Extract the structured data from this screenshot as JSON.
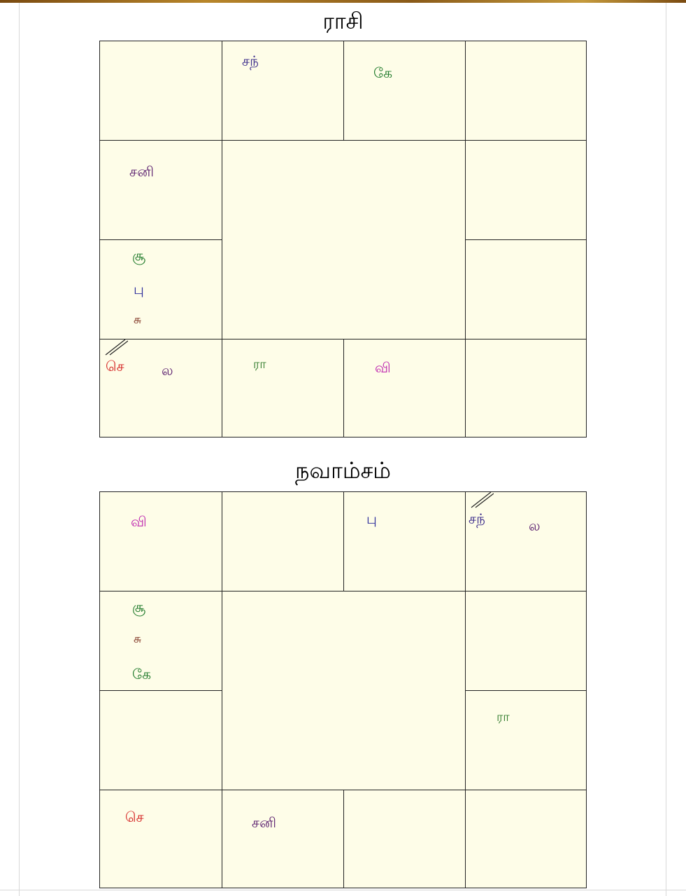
{
  "rasi": {
    "title": "ராசி",
    "cells": {
      "c1": {
        "planets": []
      },
      "c2": {
        "planets": [
          {
            "label": "சந்",
            "color": "#3a2a8a"
          }
        ]
      },
      "c3": {
        "planets": [
          {
            "label": "கே",
            "color": "#1f7a2a"
          }
        ]
      },
      "c4": {
        "planets": []
      },
      "c12": {
        "planets": [
          {
            "label": "சனி",
            "color": "#5a1e6e"
          }
        ]
      },
      "c11": {
        "planets": [
          {
            "label": "சூ",
            "color": "#1f7a2a"
          },
          {
            "label": "பு",
            "color": "#2a2a9a"
          },
          {
            "label": "சு",
            "color": "#7a2a1a"
          }
        ]
      },
      "c10": {
        "planets": [
          {
            "label": "செ",
            "color": "#d42020"
          },
          {
            "label": "ல",
            "color": "#5a1e6e"
          }
        ],
        "lagna": true
      },
      "c9": {
        "planets": [
          {
            "label": "ரா",
            "color": "#2f7a2a"
          }
        ]
      },
      "c8": {
        "planets": [
          {
            "label": "வி",
            "color": "#c02ab0"
          }
        ]
      },
      "c7": {
        "planets": []
      },
      "c6": {
        "planets": []
      },
      "c5": {
        "planets": []
      }
    }
  },
  "navamsa": {
    "title": "நவாம்சம்",
    "cells": {
      "n1": {
        "planets": [
          {
            "label": "வி",
            "color": "#c02ab0"
          }
        ]
      },
      "n2": {
        "planets": []
      },
      "n3": {
        "planets": [
          {
            "label": "பு",
            "color": "#2a2a9a"
          }
        ]
      },
      "n4": {
        "planets": [
          {
            "label": "சந்",
            "color": "#3a2a8a"
          },
          {
            "label": "ல",
            "color": "#5a1e6e"
          }
        ],
        "lagna": true
      },
      "n12": {
        "planets": [
          {
            "label": "சூ",
            "color": "#1f7a2a"
          },
          {
            "label": "சு",
            "color": "#7a2a1a"
          },
          {
            "label": "கே",
            "color": "#1f7a2a"
          }
        ]
      },
      "n5": {
        "planets": []
      },
      "n11": {
        "planets": []
      },
      "n6": {
        "planets": [
          {
            "label": "ரா",
            "color": "#2f7a2a"
          }
        ]
      },
      "n10": {
        "planets": [
          {
            "label": "செ",
            "color": "#d42020"
          }
        ]
      },
      "n9": {
        "planets": [
          {
            "label": "சனி",
            "color": "#5a1e6e"
          }
        ]
      },
      "n8": {
        "planets": []
      },
      "n7": {
        "planets": []
      }
    }
  }
}
